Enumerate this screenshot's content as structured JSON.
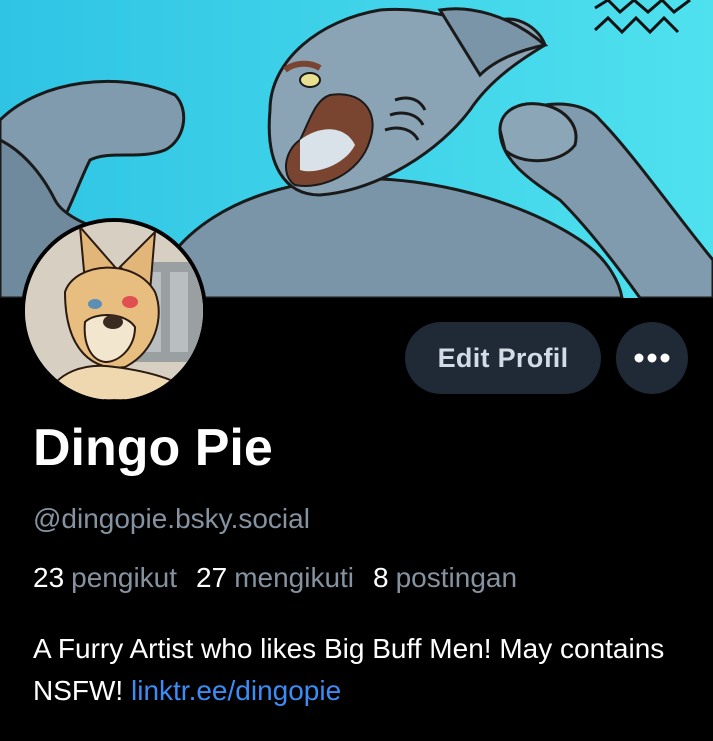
{
  "profile": {
    "display_name": "Dingo Pie",
    "handle": "@dingopie.bsky.social",
    "bio_text": "A Furry Artist who likes Big Buff Men! May contains NSFW! ",
    "bio_link": "linktr.ee/dingopie"
  },
  "stats": [
    {
      "count": "23",
      "label": "pengikut"
    },
    {
      "count": "27",
      "label": "mengikuti"
    },
    {
      "count": "8",
      "label": "postingan"
    }
  ],
  "actions": {
    "edit_label": "Edit Profil",
    "more_icon": "ellipsis-icon"
  },
  "colors": {
    "background": "#000000",
    "button_bg": "#1f2a36",
    "muted_text": "#8592a0",
    "link": "#3b8cf5",
    "banner_sky": "#3fd2e6"
  }
}
